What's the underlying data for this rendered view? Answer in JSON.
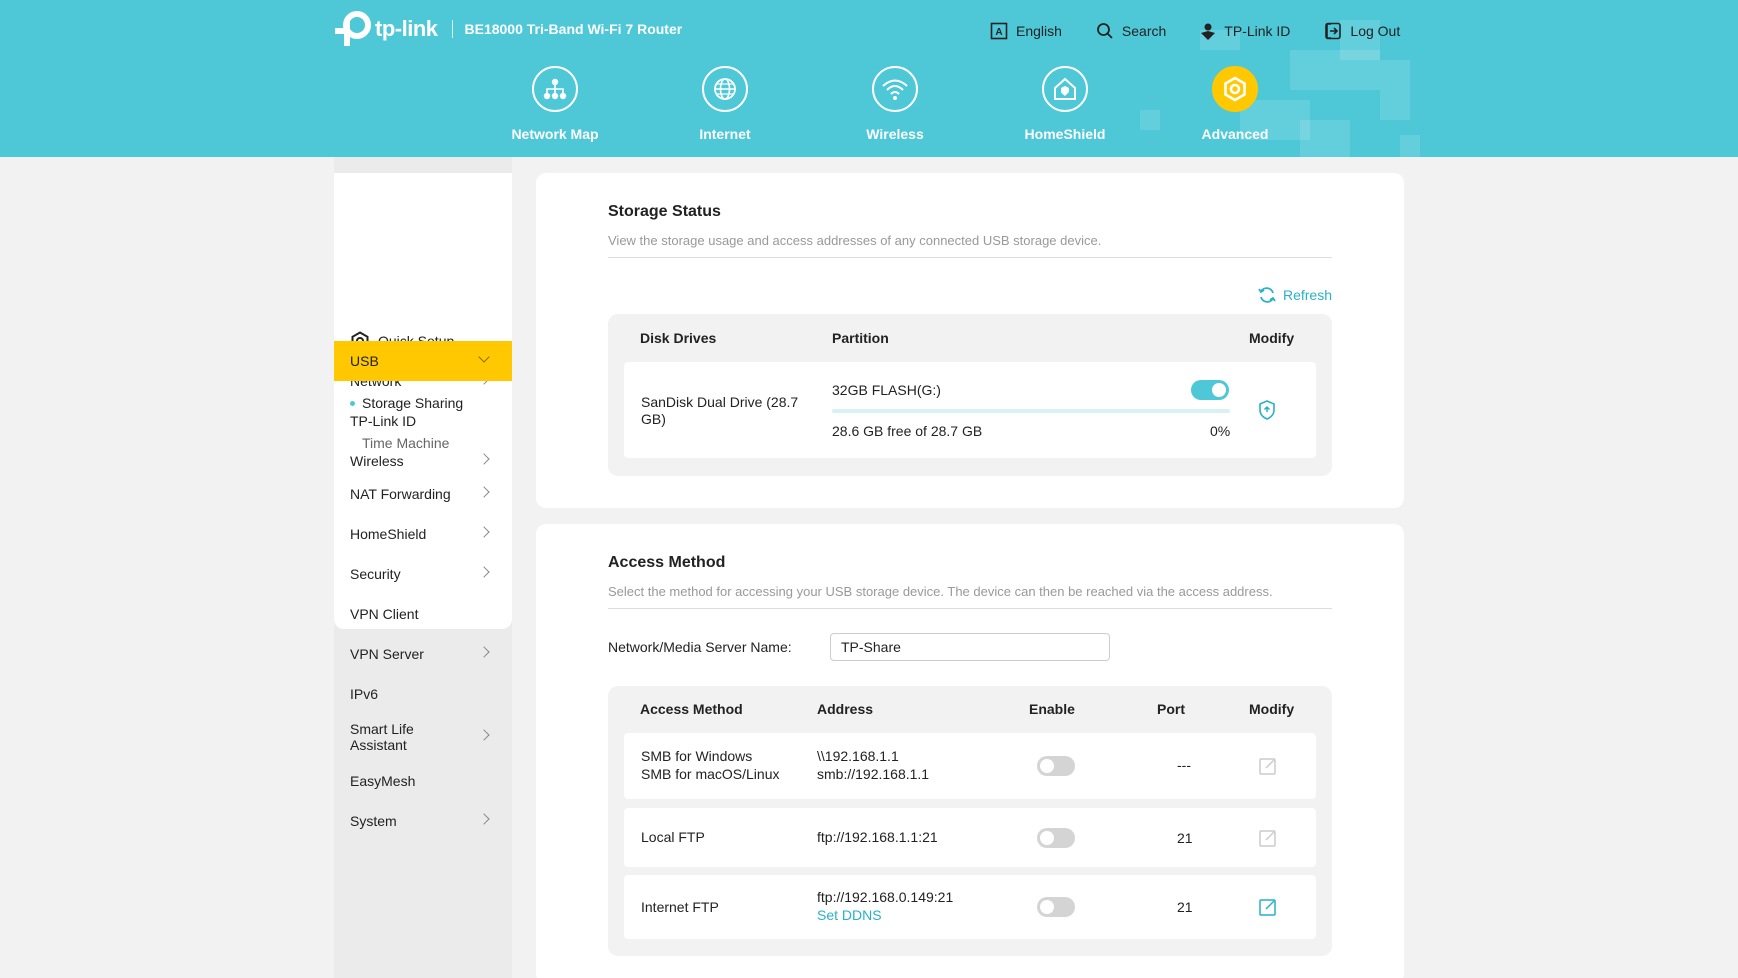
{
  "header": {
    "brand": "tp-link",
    "model": "BE18000 Tri-Band Wi-Fi 7 Router",
    "top_links": [
      {
        "label": "English",
        "icon": "language-icon"
      },
      {
        "label": "Search",
        "icon": "search-icon"
      },
      {
        "label": "TP-Link ID",
        "icon": "tplink-id-icon"
      },
      {
        "label": "Log Out",
        "icon": "logout-icon"
      }
    ],
    "tabs": [
      {
        "label": "Network Map",
        "icon": "network-map-icon"
      },
      {
        "label": "Internet",
        "icon": "globe-icon"
      },
      {
        "label": "Wireless",
        "icon": "wifi-icon"
      },
      {
        "label": "HomeShield",
        "icon": "homeshield-icon"
      },
      {
        "label": "Advanced",
        "icon": "gear-icon",
        "active": true
      }
    ]
  },
  "sidebar": {
    "items": [
      {
        "label": "Quick Setup",
        "icon": "quick-setup-icon"
      },
      {
        "label": "Network"
      },
      {
        "label": "TP-Link ID"
      },
      {
        "label": "Wireless"
      },
      {
        "label": "USB",
        "active": true
      },
      {
        "label": "Storage Sharing",
        "selected": true
      },
      {
        "label": "Time Machine"
      },
      {
        "label": "NAT Forwarding"
      },
      {
        "label": "HomeShield"
      },
      {
        "label": "Security"
      },
      {
        "label": "VPN Client"
      },
      {
        "label": "VPN Server"
      },
      {
        "label": "IPv6"
      },
      {
        "label": "Smart Life Assistant"
      },
      {
        "label": "EasyMesh"
      },
      {
        "label": "System"
      }
    ]
  },
  "storage_status": {
    "title": "Storage Status",
    "description": "View the storage usage and access addresses of any connected USB storage device.",
    "refresh_label": "Refresh",
    "columns": [
      "Disk Drives",
      "Partition",
      "Modify"
    ],
    "disk": {
      "name": "SanDisk   Dual Drive (28.7 GB)",
      "partition": "32GB FLASH(G:)",
      "enabled": true,
      "free_text": "28.6 GB free of 28.7 GB",
      "usage_percent": "0%",
      "usage_fraction": 0.0
    }
  },
  "access_method": {
    "title": "Access Method",
    "description": "Select the method for accessing your USB storage device. The device can then be reached via the access address.",
    "server_name_label": "Network/Media Server Name:",
    "server_name_value": "TP-Share",
    "columns": [
      "Access Method",
      "Address",
      "Enable",
      "Port",
      "Modify"
    ],
    "rows": [
      {
        "method_line1": "SMB for Windows",
        "method_line2": "SMB for macOS/Linux",
        "address_line1": "\\\\192.168.1.1",
        "address_line2": "smb://192.168.1.1",
        "enabled": false,
        "port": "---"
      },
      {
        "method_line1": "Local FTP",
        "address_line1": "ftp://192.168.1.1:21",
        "enabled": false,
        "port": "21"
      },
      {
        "method_line1": "Internet FTP",
        "address_line1": "ftp://192.168.0.149:21",
        "address_link": "Set DDNS",
        "enabled": false,
        "port": "21"
      }
    ]
  },
  "colors": {
    "header_bg": "#4ec8d7",
    "accent": "#ffc800",
    "link": "#27b2c6"
  }
}
